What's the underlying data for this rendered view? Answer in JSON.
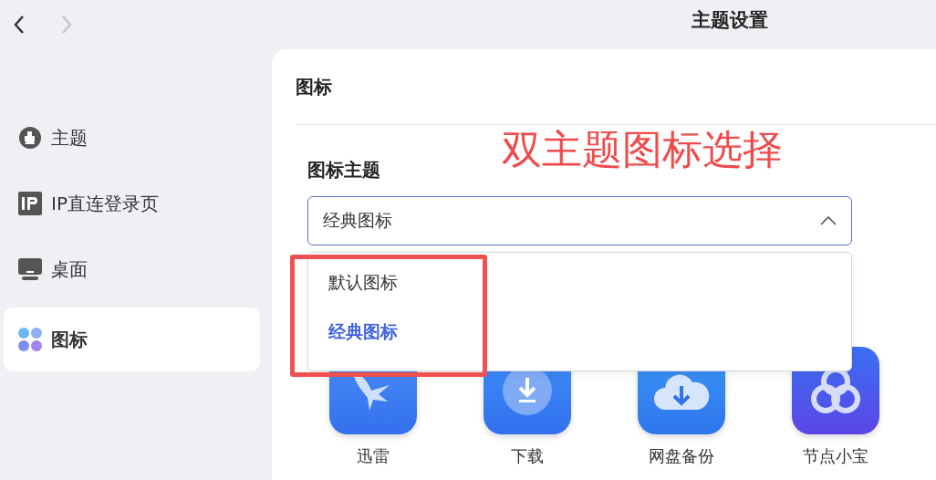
{
  "window": {
    "title": "主题设置",
    "back_enabled": true,
    "forward_enabled": false
  },
  "sidebar": {
    "items": [
      {
        "label": "主题",
        "kind": "brush",
        "selected": false
      },
      {
        "label": "IP直连登录页",
        "kind": "ip",
        "selected": false
      },
      {
        "label": "桌面",
        "kind": "monitor",
        "selected": false
      },
      {
        "label": "图标",
        "kind": "grid",
        "selected": true
      }
    ]
  },
  "section": {
    "title": "图标"
  },
  "annotation": {
    "text": "双主题图标选择"
  },
  "icon_theme": {
    "label": "图标主题",
    "value": "经典图标",
    "expanded": true,
    "options": [
      {
        "label": "默认图标",
        "selected": false
      },
      {
        "label": "经典图标",
        "selected": true
      }
    ]
  },
  "apps": [
    {
      "label": "迅雷",
      "kind": "bird"
    },
    {
      "label": "下载",
      "kind": "download"
    },
    {
      "label": "网盘备份",
      "kind": "cloud"
    },
    {
      "label": "节点小宝",
      "kind": "knot"
    }
  ]
}
